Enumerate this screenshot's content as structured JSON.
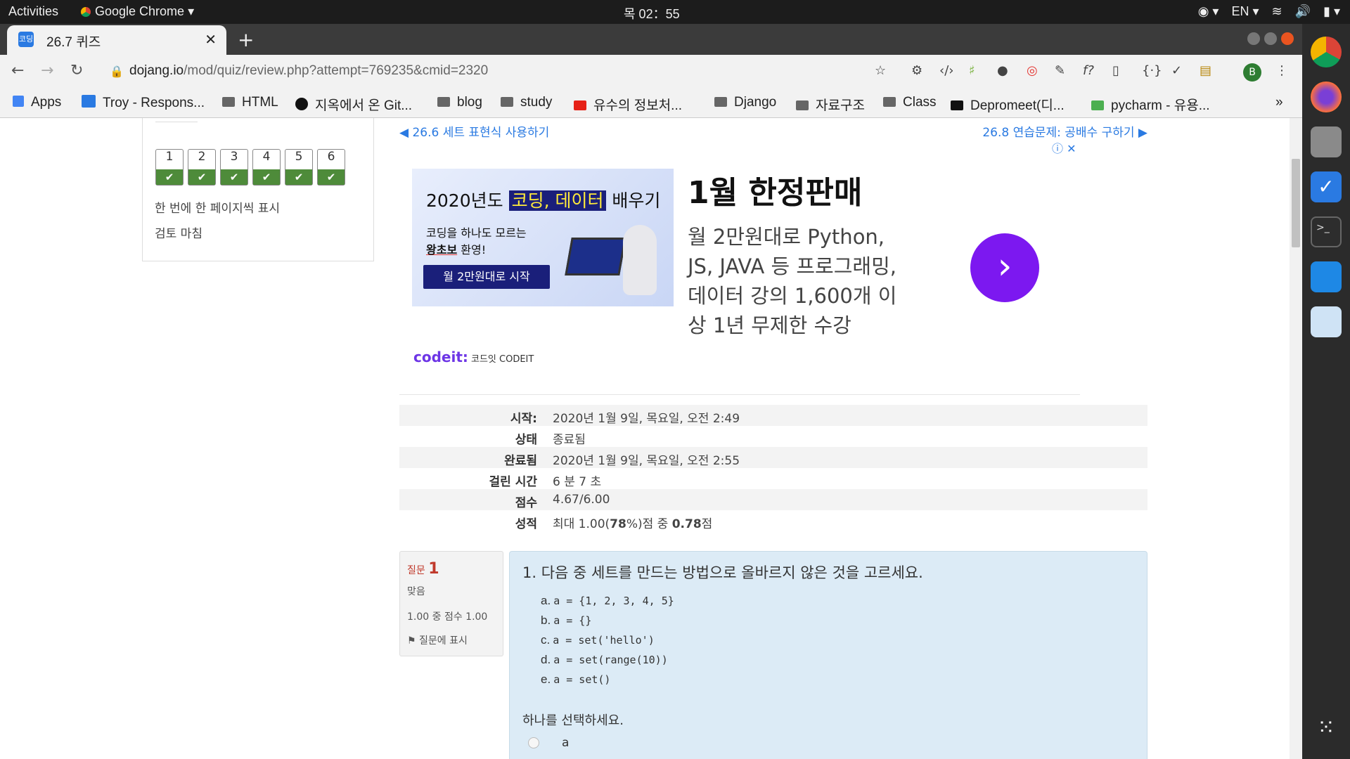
{
  "system": {
    "activities": "Activities",
    "app_name": "Google Chrome",
    "clock": "목 02：55",
    "lang": "EN"
  },
  "browser": {
    "tab_title": "26.7 퀴즈",
    "tab_favicon": "코딩",
    "url_host": "dojang.io",
    "url_path": "/mod/quiz/review.php?attempt=769235&cmid=2320",
    "profile_initial": "B",
    "bookmarks": [
      {
        "label": "Apps",
        "icon": "apps-grid-icon"
      },
      {
        "label": "Troy - Respons...",
        "icon": "trello-icon"
      },
      {
        "label": "HTML",
        "icon": "folder-icon"
      },
      {
        "label": "지옥에서 온 Git...",
        "icon": "github-icon"
      },
      {
        "label": "blog",
        "icon": "folder-icon"
      },
      {
        "label": "study",
        "icon": "folder-icon"
      },
      {
        "label": "유수의 정보처...",
        "icon": "youtube-icon"
      },
      {
        "label": "Django",
        "icon": "folder-icon"
      },
      {
        "label": "자료구조",
        "icon": "folder-icon"
      },
      {
        "label": "Class",
        "icon": "folder-icon"
      },
      {
        "label": "Depromeet(디...",
        "icon": "medium-icon"
      },
      {
        "label": "pycharm - 유용...",
        "icon": "doc-icon"
      }
    ]
  },
  "sidebar": {
    "question_numbers": [
      "1",
      "2",
      "3",
      "4",
      "5",
      "6"
    ],
    "show_one_page": "한 번에 한 페이지씩 표시",
    "finish_review": "검토 마침"
  },
  "nav": {
    "prev": "◀ 26.6 세트 표현식 사용하기",
    "next": "26.8 연습문제: 공배수 구하기 ▶"
  },
  "ad": {
    "image_headline_pre": "2020년도 ",
    "image_headline_hl": "코딩, 데이터",
    "image_headline_post": " 배우기",
    "image_sub1": "코딩을 하나도 모르는",
    "image_sub2_bold": "왕초보",
    "image_sub2_rest": " 환영!",
    "image_button": "월 2만원대로 시작",
    "headline": "1월 한정판매",
    "body": "월 2만원대로 Python, JS, JAVA 등 프로그래밍, 데이터 강의 1,600개 이상 1년 무제한 수강",
    "brand_logo": "codeit:",
    "brand_name": "코드잇 CODEIT",
    "info_icons": "ⓘ ✕"
  },
  "summary": [
    {
      "label": "시작:",
      "value": "2020년 1월 9일, 목요일, 오전 2:49"
    },
    {
      "label": "상태",
      "value": "종료됨"
    },
    {
      "label": "완료됨",
      "value": "2020년 1월 9일, 목요일, 오전 2:55"
    },
    {
      "label": "걸린 시간",
      "value": "6 분 7 초"
    },
    {
      "label": "점수",
      "value": "4.67/6.00"
    },
    {
      "label": "성적",
      "value_pre": "최대 1.00(",
      "value_b1": "78",
      "value_mid": "%)점 중 ",
      "value_b2": "0.78",
      "value_post": "점"
    }
  ],
  "question": {
    "label": "질문",
    "number": "1",
    "status": "맞음",
    "score": "1.00 중 점수 1.00",
    "flag": "질문에 표시",
    "text": "1. 다음 중 세트를 만드는 방법으로 올바르지 않은 것을 고르세요.",
    "options": [
      {
        "letter": "a.",
        "code": "a = {1, 2, 3, 4, 5}"
      },
      {
        "letter": "b.",
        "code": "a = {}"
      },
      {
        "letter": "c.",
        "code": "a = set('hello')"
      },
      {
        "letter": "d.",
        "code": "a = set(range(10))"
      },
      {
        "letter": "e.",
        "code": "a = set()"
      }
    ],
    "prompt": "하나를 선택하세요.",
    "first_answer": "a"
  },
  "colors": {
    "link": "#2a7ae2",
    "correct": "#4e8b3a",
    "ad_cta": "#7c18f0",
    "question_bg": "#dcebf6"
  }
}
